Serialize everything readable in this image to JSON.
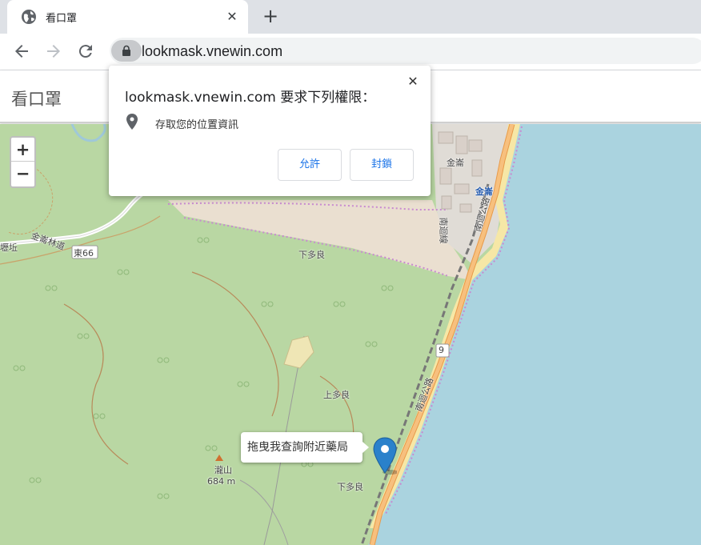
{
  "browser": {
    "tab_title": "看口罩",
    "tab_close": "✕",
    "new_tab": "+",
    "url": "lookmask.vnewin.com"
  },
  "page": {
    "title": "看口罩"
  },
  "map": {
    "zoom_in": "+",
    "zoom_out": "−",
    "tooltip": "拖曳我查詢附近藥局",
    "labels": {
      "jinshan": "金崙",
      "jinshan_station": "金崙",
      "xiaduoliang_1": "下多良",
      "shangduoliang": "上多良",
      "xiaduoliang_2": "下多良",
      "dong66": "東66",
      "road_jinlun": "金崙林道",
      "route9": "9",
      "shanshan": "瀧山",
      "shanshan_elev": "684 m",
      "lipei": "壢坵",
      "nanhui": "南迴公路",
      "rail": "南迴線",
      "hwy": "南迴公路"
    },
    "colors": {
      "land": "#b9d7a3",
      "sea": "#aad3df",
      "sand": "#f0e4c8",
      "road": "#f7c07e",
      "marker": "#2a81cb"
    }
  },
  "permission_popup": {
    "title": "lookmask.vnewin.com 要求下列權限：",
    "close": "✕",
    "permission": "存取您的位置資訊",
    "allow": "允許",
    "block": "封鎖"
  }
}
